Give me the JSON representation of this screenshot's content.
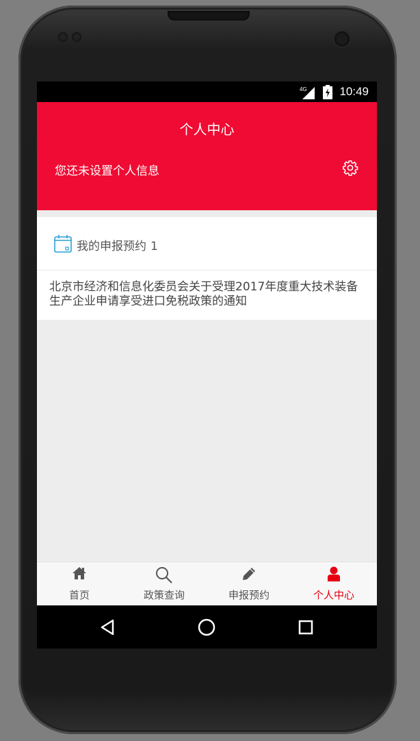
{
  "status_bar": {
    "time": "10:49",
    "network": "4G"
  },
  "header": {
    "title": "个人中心",
    "info": "您还未设置个人信息",
    "settings_icon": "gear-icon"
  },
  "appointments": {
    "label": "我的申报预约",
    "count": "1",
    "icon": "calendar-icon",
    "items": [
      {
        "title": "北京市经济和信息化委员会关于受理2017年度重大技术装备生产企业申请享受进口免税政策的通知"
      }
    ]
  },
  "tabs": [
    {
      "label": "首页",
      "icon": "home-icon",
      "active": false
    },
    {
      "label": "政策查询",
      "icon": "search-icon",
      "active": false
    },
    {
      "label": "申报预约",
      "icon": "pencil-icon",
      "active": false
    },
    {
      "label": "个人中心",
      "icon": "user-icon",
      "active": true
    }
  ],
  "colors": {
    "brand": "#ef0b33",
    "active_tab": "#e60012",
    "calendar": "#2a9fd6"
  }
}
